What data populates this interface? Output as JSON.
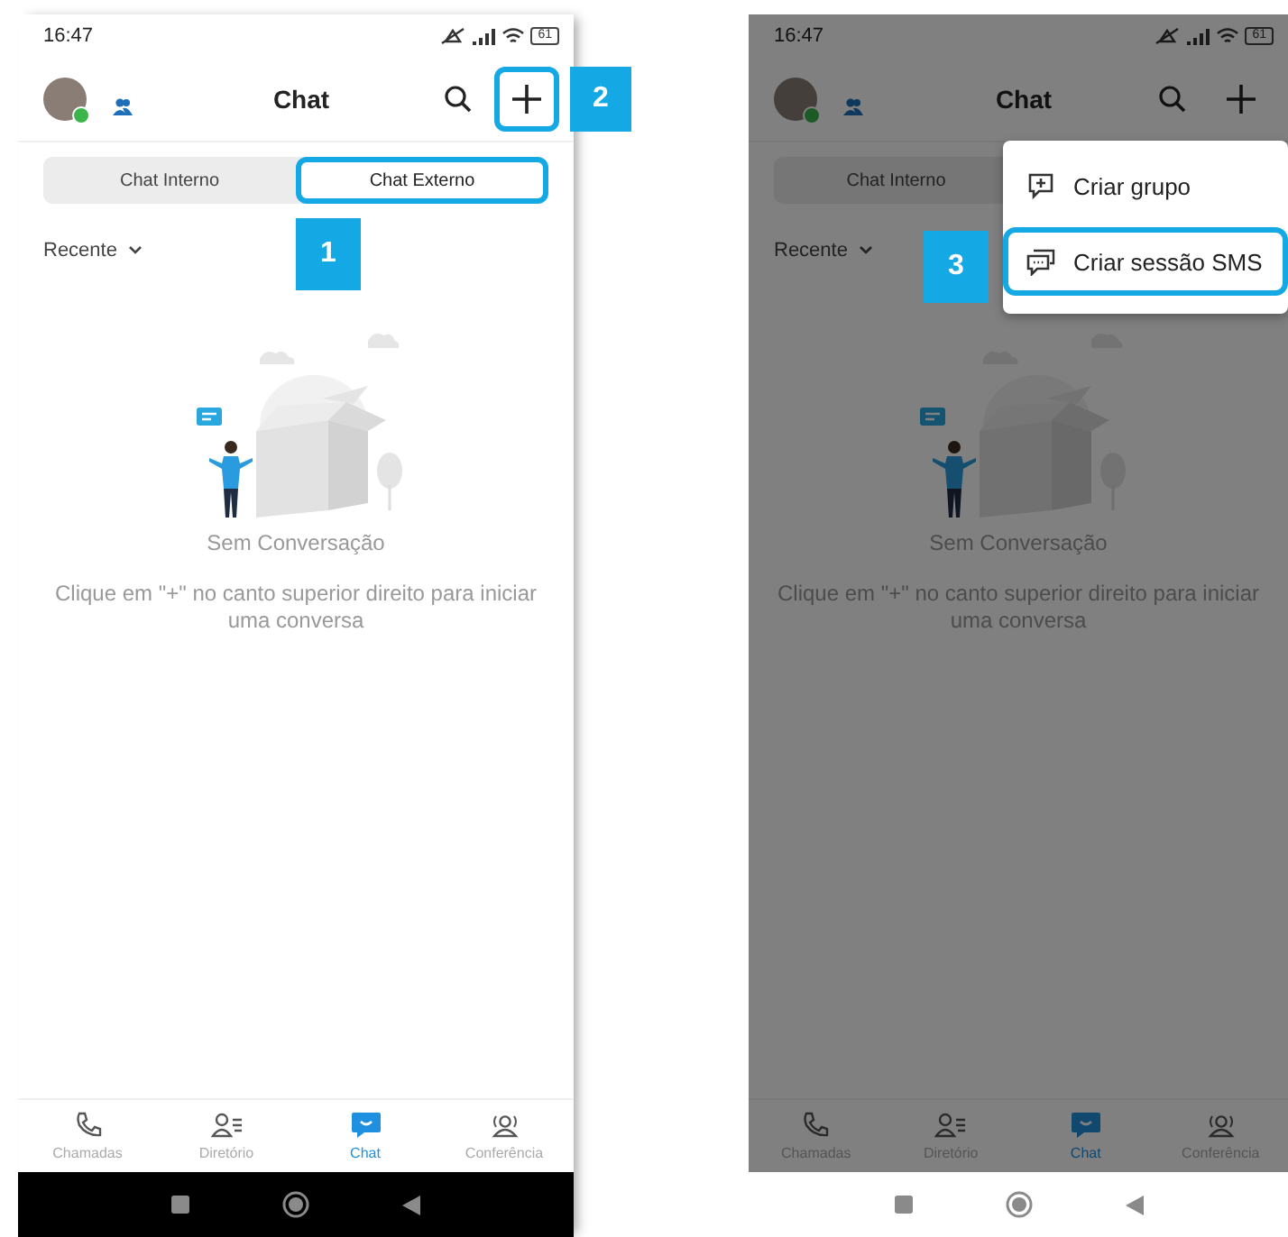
{
  "screens": [
    {
      "dimmed": false,
      "dark_system_bar": true,
      "status": {
        "time": "16:47",
        "battery": "61"
      },
      "title": "Chat",
      "plus_button": {
        "highlighted": true,
        "callout": "2"
      },
      "tabs": [
        {
          "label": "Chat Interno",
          "selected": false,
          "highlighted": false
        },
        {
          "label": "Chat Externo",
          "selected": true,
          "highlighted": true,
          "callout": "1"
        }
      ],
      "filter": "Recente",
      "empty_title": "Sem Conversação",
      "empty_hint": "Clique em \"+\" no canto superior direito para iniciar uma conversa",
      "nav": [
        {
          "label": "Chamadas",
          "selected": false
        },
        {
          "label": "Diretório",
          "selected": false
        },
        {
          "label": "Chat",
          "selected": true
        },
        {
          "label": "Conferência",
          "selected": false
        }
      ]
    },
    {
      "dimmed": true,
      "dark_system_bar": false,
      "status": {
        "time": "16:47",
        "battery": "61"
      },
      "title": "Chat",
      "plus_button": {
        "highlighted": false
      },
      "tabs": [
        {
          "label": "Chat Interno",
          "selected": false,
          "highlighted": false
        }
      ],
      "filter": "Recente",
      "empty_title": "Sem Conversação",
      "empty_hint": "Clique em \"+\" no canto superior direito para iniciar uma conversa",
      "nav": [
        {
          "label": "Chamadas",
          "selected": false
        },
        {
          "label": "Diretório",
          "selected": false
        },
        {
          "label": "Chat",
          "selected": true
        },
        {
          "label": "Conferência",
          "selected": false
        }
      ],
      "menu": {
        "items": [
          {
            "label": "Criar grupo",
            "highlighted": false
          },
          {
            "label": "Criar sessão SMS",
            "highlighted": true,
            "callout": "3"
          }
        ]
      }
    }
  ]
}
